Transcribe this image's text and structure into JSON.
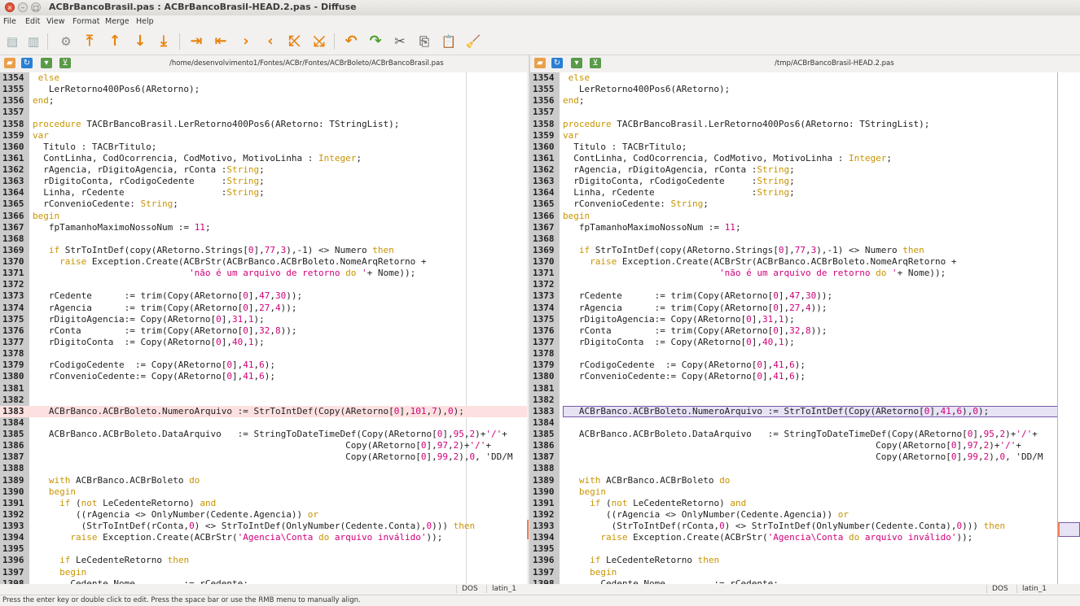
{
  "window": {
    "title": "ACBrBancoBrasil.pas : ACBrBancoBrasil-HEAD.2.pas - Diffuse"
  },
  "menu": [
    "File",
    "Edit",
    "View",
    "Format",
    "Merge",
    "Help"
  ],
  "status": {
    "message": "Press the enter key or double click to edit.  Press the space bar or use the RMB menu to manually align."
  },
  "panes": [
    {
      "path": "/home/desenvolvimento1/Fontes/ACBr/Fontes/ACBrBoleto/ACBrBancoBrasil.pas",
      "eol": "DOS",
      "encoding": "latin_1"
    },
    {
      "path": "/tmp/ACBrBancoBrasil-HEAD.2.pas",
      "eol": "DOS",
      "encoding": "latin_1"
    }
  ],
  "lines": [
    {
      "n": "1354",
      "t": " else"
    },
    {
      "n": "1355",
      "t": "   LerRetorno400Pos6(ARetorno);"
    },
    {
      "n": "1356",
      "t": "end;"
    },
    {
      "n": "1357",
      "t": ""
    },
    {
      "n": "1358",
      "t": "procedure TACBrBancoBrasil.LerRetorno400Pos6(ARetorno: TStringList);"
    },
    {
      "n": "1359",
      "t": "var"
    },
    {
      "n": "1360",
      "t": "  Titulo : TACBrTitulo;"
    },
    {
      "n": "1361",
      "t": "  ContLinha, CodOcorrencia, CodMotivo, MotivoLinha : Integer;"
    },
    {
      "n": "1362",
      "t": "  rAgencia, rDigitoAgencia, rConta :String;"
    },
    {
      "n": "1363",
      "t": "  rDigitoConta, rCodigoCedente     :String;"
    },
    {
      "n": "1364",
      "t": "  Linha, rCedente                  :String;"
    },
    {
      "n": "1365",
      "t": "  rConvenioCedente: String;"
    },
    {
      "n": "1366",
      "t": "begin"
    },
    {
      "n": "1367",
      "t": "   fpTamanhoMaximoNossoNum := 11;"
    },
    {
      "n": "1368",
      "t": ""
    },
    {
      "n": "1369",
      "t": "   if StrToIntDef(copy(ARetorno.Strings[0],77,3),-1) <> Numero then"
    },
    {
      "n": "1370",
      "t": "     raise Exception.Create(ACBrStr(ACBrBanco.ACBrBoleto.NomeArqRetorno +"
    },
    {
      "n": "1371",
      "t": "                             'não é um arquivo de retorno do '+ Nome));"
    },
    {
      "n": "1372",
      "t": ""
    },
    {
      "n": "1373",
      "t": "   rCedente      := trim(Copy(ARetorno[0],47,30));"
    },
    {
      "n": "1374",
      "t": "   rAgencia      := trim(Copy(ARetorno[0],27,4));"
    },
    {
      "n": "1375",
      "t": "   rDigitoAgencia:= Copy(ARetorno[0],31,1);"
    },
    {
      "n": "1376",
      "t": "   rConta        := trim(Copy(ARetorno[0],32,8));"
    },
    {
      "n": "1377",
      "t": "   rDigitoConta  := Copy(ARetorno[0],40,1);"
    },
    {
      "n": "1378",
      "t": ""
    },
    {
      "n": "1379",
      "t": "   rCodigoCedente  := Copy(ARetorno[0],41,6);"
    },
    {
      "n": "1380",
      "t": "   rConvenioCedente:= Copy(ARetorno[0],41,6);"
    },
    {
      "n": "1381",
      "t": ""
    },
    {
      "n": "1382",
      "t": ""
    },
    {
      "n": "1383",
      "t": "   ACBrBanco.ACBrBoleto.NumeroArquivo := StrToIntDef(Copy(ARetorno[0],101,7),0);",
      "tr": "   ACBrBanco.ACBrBoleto.NumeroArquivo := StrToIntDef(Copy(ARetorno[0],41,6),0);"
    },
    {
      "n": "1384",
      "t": ""
    },
    {
      "n": "1385",
      "t": "   ACBrBanco.ACBrBoleto.DataArquivo   := StringToDateTimeDef(Copy(ARetorno[0],95,2)+'/'+"
    },
    {
      "n": "1386",
      "t": "                                                          Copy(ARetorno[0],97,2)+'/'+"
    },
    {
      "n": "1387",
      "t": "                                                          Copy(ARetorno[0],99,2),0, 'DD/M"
    },
    {
      "n": "1388",
      "t": ""
    },
    {
      "n": "1389",
      "t": "   with ACBrBanco.ACBrBoleto do"
    },
    {
      "n": "1390",
      "t": "   begin"
    },
    {
      "n": "1391",
      "t": "     if (not LeCedenteRetorno) and"
    },
    {
      "n": "1392",
      "t": "        ((rAgencia <> OnlyNumber(Cedente.Agencia)) or"
    },
    {
      "n": "1393",
      "t": "         (StrToIntDef(rConta,0) <> StrToIntDef(OnlyNumber(Cedente.Conta),0))) then"
    },
    {
      "n": "1394",
      "t": "       raise Exception.Create(ACBrStr('Agencia\\Conta do arquivo inválido'));"
    },
    {
      "n": "1395",
      "t": ""
    },
    {
      "n": "1396",
      "t": "     if LeCedenteRetorno then"
    },
    {
      "n": "1397",
      "t": "     begin"
    },
    {
      "n": "1398",
      "t": "       Cedente.Nome         := rCedente;"
    }
  ]
}
